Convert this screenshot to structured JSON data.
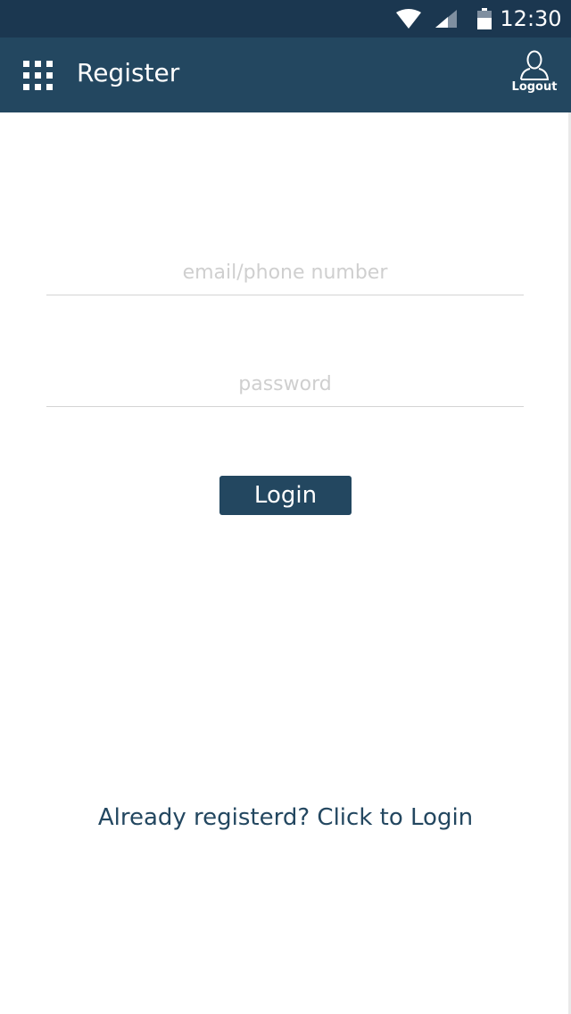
{
  "status_bar": {
    "time": "12:30",
    "icons": [
      "wifi-icon",
      "signal-icon",
      "battery-icon"
    ]
  },
  "app_bar": {
    "title": "Register",
    "menu_icon": "grid-menu-icon",
    "logout_label": "Logout",
    "logout_icon": "user-icon"
  },
  "form": {
    "email_placeholder": "email/phone number",
    "email_value": "",
    "password_placeholder": "password",
    "password_value": "",
    "login_label": "Login"
  },
  "footer": {
    "already_registered": "Already registerd? Click to Login"
  },
  "colors": {
    "status_bar": "#1b3750",
    "app_bar": "#234760",
    "accent": "#234760",
    "placeholder": "#cfcfcf",
    "divider": "#d4d4d4"
  }
}
